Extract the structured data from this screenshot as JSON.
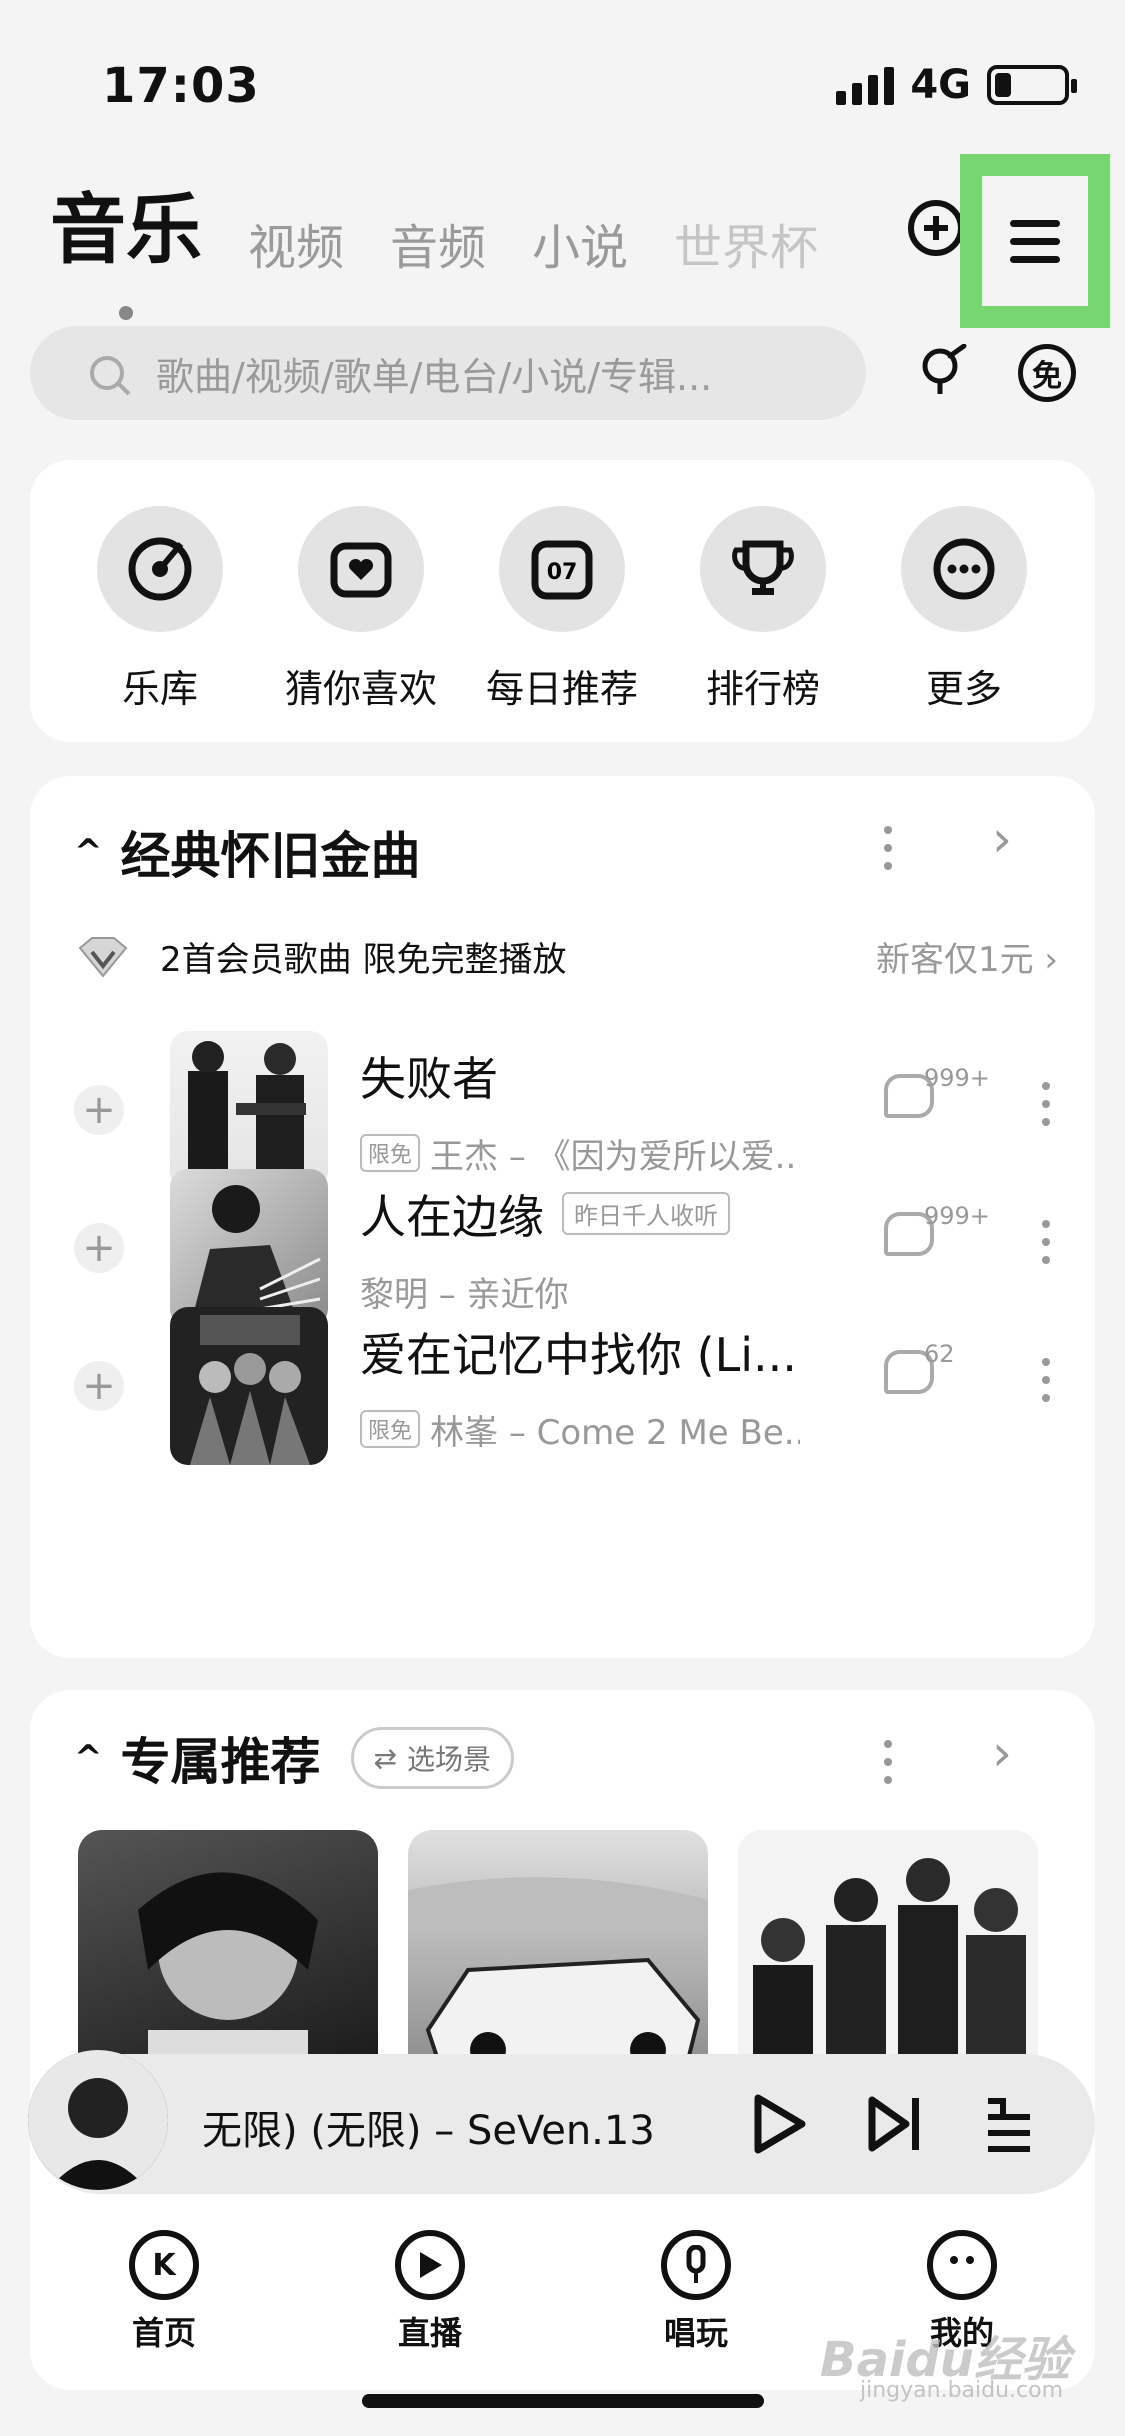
{
  "status": {
    "time": "17:03",
    "network": "4G"
  },
  "tabs": [
    {
      "label": "音乐"
    },
    {
      "label": "视频"
    },
    {
      "label": "音频"
    },
    {
      "label": "小说"
    },
    {
      "label": "世界杯"
    }
  ],
  "search": {
    "placeholder": "歌曲/视频/歌单/电台/小说/专辑..."
  },
  "header_icons": {
    "free": "免"
  },
  "quick": [
    {
      "label": "乐库",
      "icon": "music-library-icon"
    },
    {
      "label": "猜你喜欢",
      "icon": "heart-radio-icon"
    },
    {
      "label": "每日推荐",
      "icon": "calendar-icon",
      "badge": "07"
    },
    {
      "label": "排行榜",
      "icon": "trophy-icon"
    },
    {
      "label": "更多",
      "icon": "more-icon"
    }
  ],
  "classic": {
    "title": "经典怀旧金曲",
    "vip_text": "2首会员歌曲 限免完整播放",
    "vip_offer": "新客仅1元",
    "songs": [
      {
        "title": "失败者",
        "tag": "",
        "limited": "限免",
        "meta": "王杰 – 《因为爱所以爱...",
        "comments": "999+"
      },
      {
        "title": "人在边缘",
        "tag": "昨日千人收听",
        "limited": "",
        "meta": "黎明 – 亲近你",
        "comments": "999+"
      },
      {
        "title": "爱在记忆中找你 (Li...",
        "tag": "",
        "limited": "限免",
        "meta": "林峯 – Come 2 Me Be...",
        "comments": "62"
      }
    ]
  },
  "exclusive": {
    "title": "专属推荐",
    "scene_button": "选场景"
  },
  "player": {
    "title": "无限) (无限) – SeVen.13"
  },
  "nav": [
    {
      "label": "首页",
      "icon": "k-home-icon"
    },
    {
      "label": "直播",
      "icon": "live-play-icon"
    },
    {
      "label": "唱玩",
      "icon": "mic-icon"
    },
    {
      "label": "我的",
      "icon": "face-icon"
    }
  ],
  "watermark": {
    "main": "Baidu经验",
    "sub": "jingyan.baidu.com"
  },
  "colors": {
    "highlight": "#77d672",
    "background": "#f4f4f4",
    "card": "#ffffff"
  }
}
